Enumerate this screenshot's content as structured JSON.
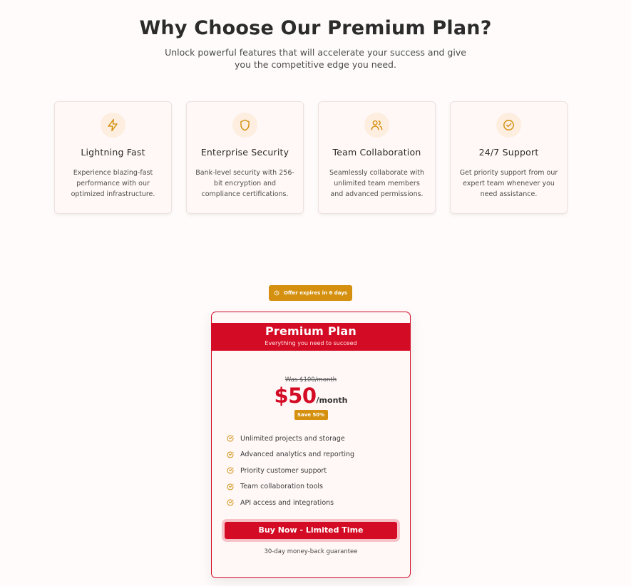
{
  "hero": {
    "title": "Why Choose Our Premium Plan?",
    "subtitle": "Unlock powerful features that will accelerate your success and give you the competitive edge you need."
  },
  "features": [
    {
      "icon": "lightning-icon",
      "title": "Lightning Fast",
      "description": "Experience blazing-fast performance with our optimized infrastructure."
    },
    {
      "icon": "shield-icon",
      "title": "Enterprise Security",
      "description": "Bank-level security with 256-bit encryption and compliance certifications."
    },
    {
      "icon": "users-icon",
      "title": "Team Collaboration",
      "description": "Seamlessly collaborate with unlimited team members and advanced permissions."
    },
    {
      "icon": "check-circle-icon",
      "title": "24/7 Support",
      "description": "Get priority support from our expert team whenever you need assistance."
    }
  ],
  "offer": {
    "label": "Offer expires in 6 days",
    "icon": "clock-icon"
  },
  "plan": {
    "name": "Premium Plan",
    "tagline": "Everything you need to succeed",
    "was_price": "Was $100/month",
    "price": "$50",
    "period": "/month",
    "save_label": "Save 50%",
    "items": [
      "Unlimited projects and storage",
      "Advanced analytics and reporting",
      "Priority customer support",
      "Team collaboration tools",
      "API access and integrations"
    ],
    "cta": "Buy Now - Limited Time",
    "guarantee": "30-day money-back guarantee"
  },
  "colors": {
    "accent_red": "#d40b24",
    "accent_gold": "#d4900e",
    "icon_bg": "#fdeee0"
  }
}
